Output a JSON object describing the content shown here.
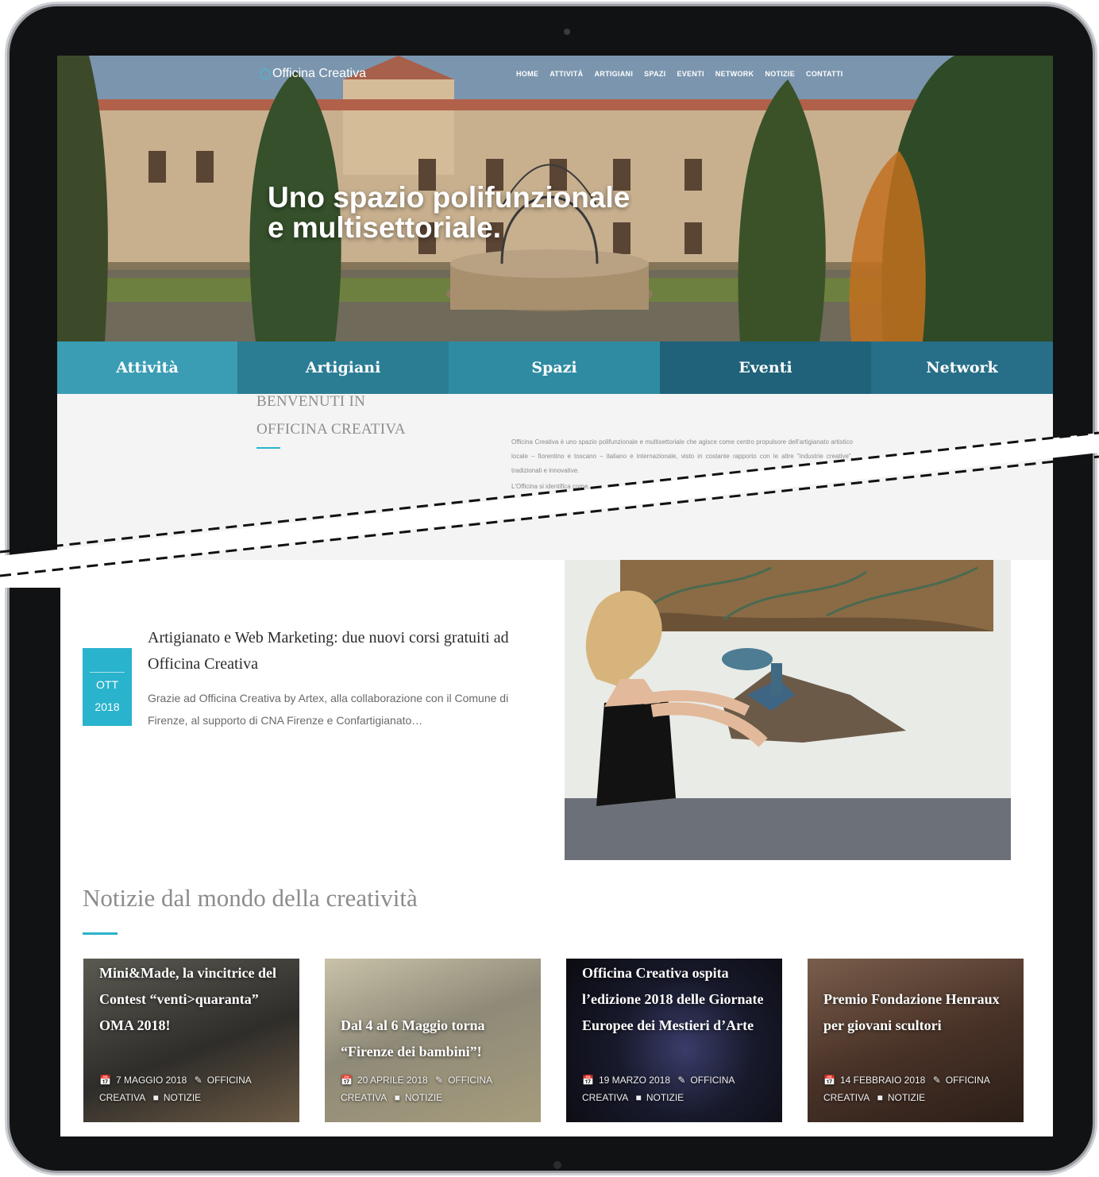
{
  "site": {
    "logo_text": "Officina Creativa",
    "nav": [
      "HOME",
      "ATTIVITÀ",
      "ARTIGIANI",
      "SPAZI",
      "EVENTI",
      "NETWORK",
      "NOTIZIE",
      "CONTATTI"
    ]
  },
  "hero": {
    "title_line1": "Uno spazio polifunzionale",
    "title_line2": "e multisettoriale."
  },
  "categories": [
    {
      "label": "Attività",
      "color": "#3a9db4"
    },
    {
      "label": "Artigiani",
      "color": "#2b7d94"
    },
    {
      "label": "Spazi",
      "color": "#2f8ba2"
    },
    {
      "label": "Eventi",
      "color": "#1f627a"
    },
    {
      "label": "Network",
      "color": "#276f88"
    }
  ],
  "welcome": {
    "heading_line1": "BENVENUTI IN",
    "heading_line2": "OFFICINA CREATIVA",
    "para1": "Officina Creativa è uno spazio polifunzionale e multisettoriale che agisce come centro propulsore dell'artigianato artistico locale – fiorentino e toscano – italiano e internazionale, visto in costante rapporto con le altre \"industrie creative\", tradizionali e innovative.",
    "para2": "L'Officina si identifica come..."
  },
  "article": {
    "date_month": "OTT",
    "date_year": "2018",
    "title": "Artigianato e Web Marketing: due nuovi corsi gratuiti ad Officina Creativa",
    "excerpt": "Grazie ad Officina Creativa by Artex, alla collaborazione con il Comune di Firenze,  al  supporto di CNA Firenze e Confartigianato…"
  },
  "news": {
    "section_title": "Notizie dal mondo della creatività",
    "cards": [
      {
        "title": "Mini&Made, la vincitrice del Contest “venti>quaranta” OMA 2018!",
        "date": "7 MAGGIO 2018",
        "author": "OFFICINA CREATIVA",
        "category": "NOTIZIE"
      },
      {
        "title": "Dal 4 al 6 Maggio torna “Firenze dei bambini”!",
        "date": "20 APRILE 2018",
        "author": "OFFICINA CREATIVA",
        "category": "NOTIZIE"
      },
      {
        "title": "Officina Creativa ospita l’edizione 2018 delle Giornate Europee dei Mestieri d’Arte",
        "date": "19 MARZO 2018",
        "author": "OFFICINA CREATIVA",
        "category": "NOTIZIE"
      },
      {
        "title": "Premio Fondazione Henraux per giovani scultori",
        "date": "14 FEBBRAIO 2018",
        "author": "OFFICINA CREATIVA",
        "category": "NOTIZIE"
      }
    ]
  },
  "colors": {
    "accent": "#2ab3cc",
    "frame": "#111214"
  },
  "icons": [
    "calendar-icon",
    "pencil-icon",
    "folder-icon"
  ]
}
